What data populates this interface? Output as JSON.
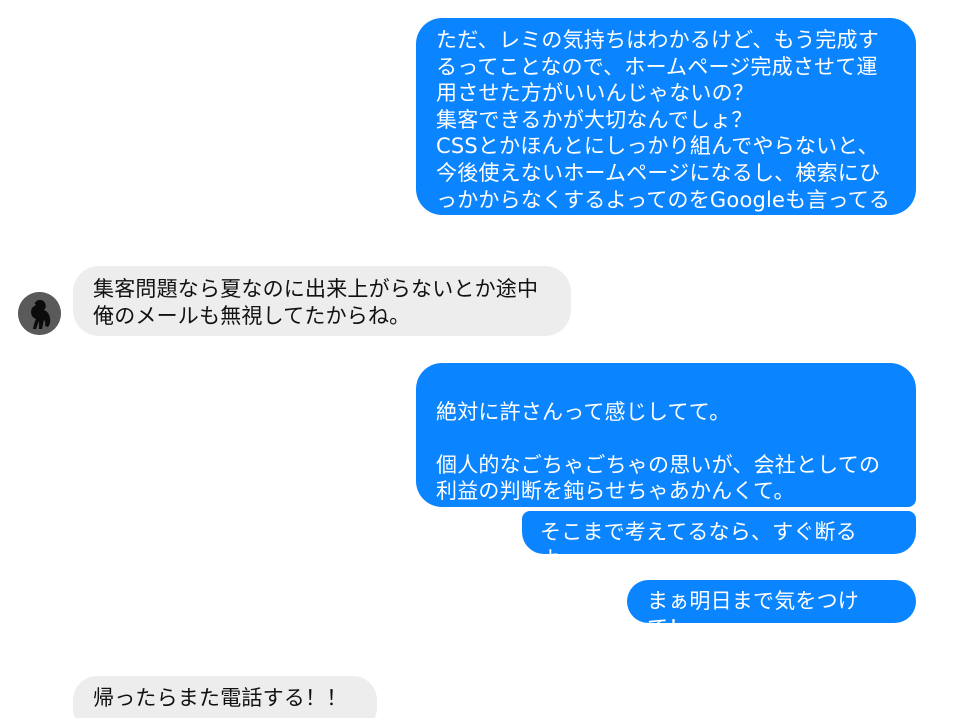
{
  "messages": [
    {
      "id": "m1",
      "direction": "outgoing",
      "text": "ただ、レミの気持ちはわかるけど、もう完成するってことなので、ホームページ完成させて運用させた方がいいんじゃないの？\n集客できるかが大切なんでしょ？\nCSSとかほんとにしっかり組んでやらないと、今後使えないホームページになるし、検索にひっかからなくするよってのをGoogleも言ってるし。"
    },
    {
      "id": "m2",
      "direction": "incoming",
      "text": "集客問題なら夏なのに出来上がらないとか途中俺のメールも無視してたからね。"
    },
    {
      "id": "m3",
      "direction": "outgoing",
      "text": "\n絶対に許さんって感じしてて。\n\n個人的なごちゃごちゃの思いが、会社としての利益の判断を鈍らせちゃあかんくて。"
    },
    {
      "id": "m4",
      "direction": "outgoing",
      "text": "そこまで考えてるなら、すぐ断るよ。"
    },
    {
      "id": "m5",
      "direction": "outgoing",
      "text": "まぁ明日まで気をつけて！"
    },
    {
      "id": "m6",
      "direction": "incoming",
      "text": "帰ったらまた電話する！！"
    }
  ],
  "colors": {
    "outgoing_bubble": "#0b84ff",
    "incoming_bubble": "#ededed",
    "outgoing_text": "#ffffff",
    "incoming_text": "#111111"
  },
  "avatar": {
    "icon": "contact-avatar-icon"
  }
}
